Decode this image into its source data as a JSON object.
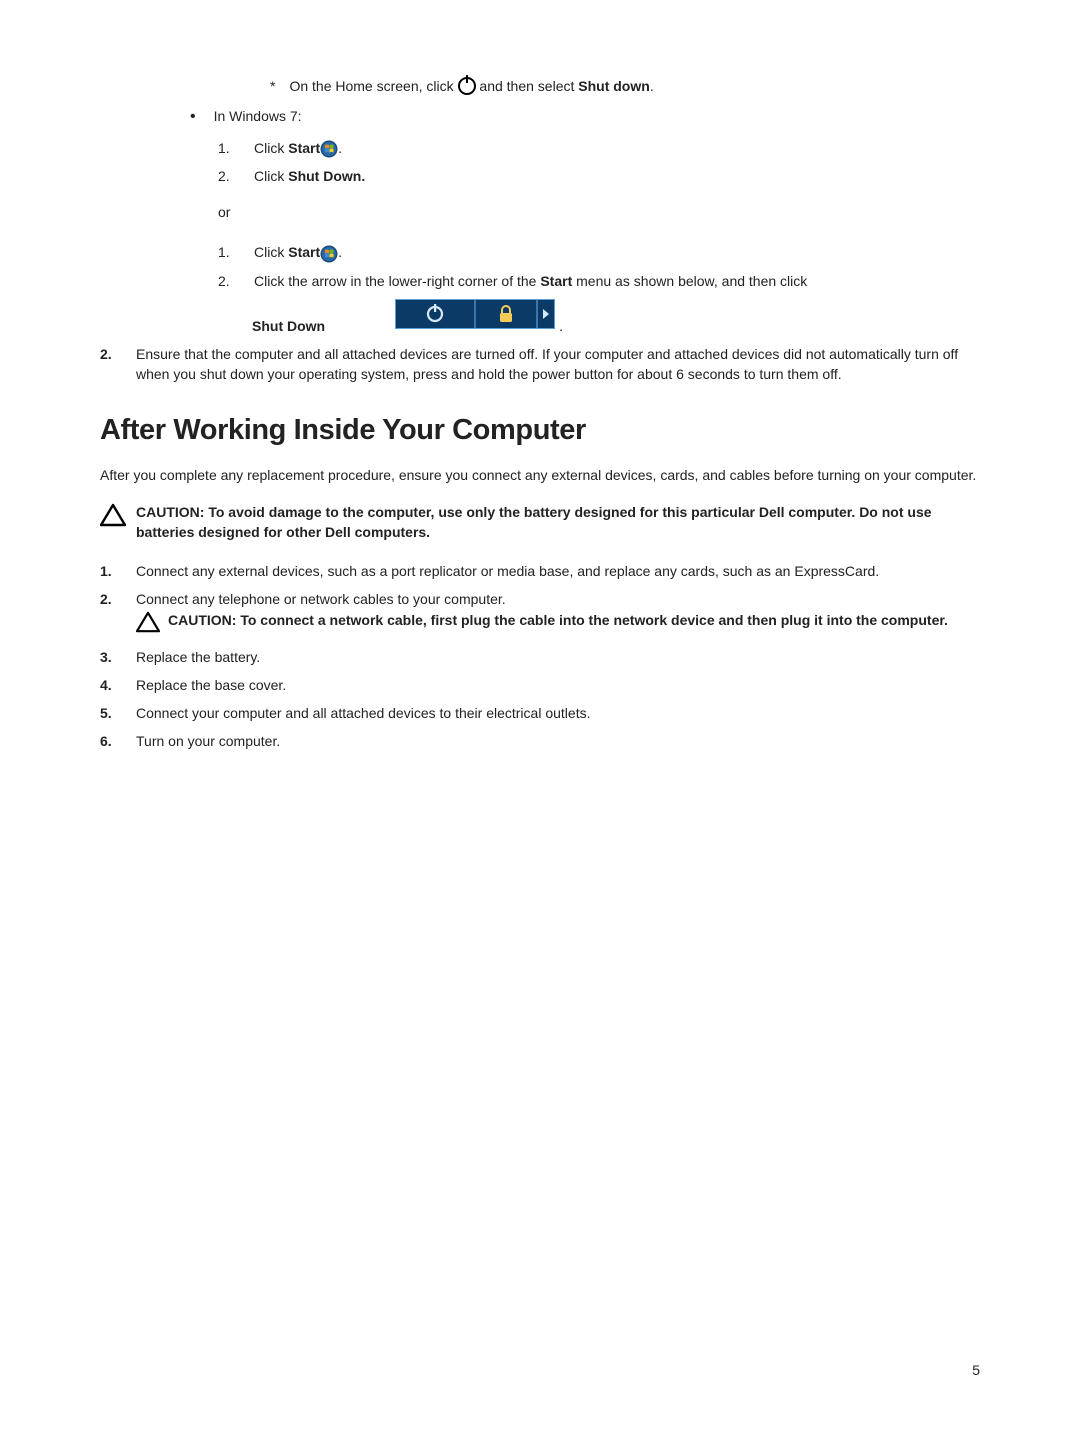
{
  "asterisk": {
    "marker": "*",
    "text_before": "On the Home screen, click ",
    "text_after": " and then select ",
    "bold_end": "Shut down",
    "period": "."
  },
  "bullet1": {
    "marker": "•",
    "text": "In Windows 7:"
  },
  "steps_a": {
    "s1_num": "1.",
    "s1_text": "Click ",
    "s1_bold": "Start",
    "s1_period": ".",
    "s2_num": "2.",
    "s2_text": "Click ",
    "s2_bold": "Shut Down."
  },
  "or_text": "or",
  "steps_b": {
    "s1_num": "1.",
    "s1_text": "Click ",
    "s1_bold": "Start",
    "s1_period": ".",
    "s2_num": "2.",
    "s2_text_before": "Click the arrow in the lower-right corner of the ",
    "s2_bold": "Start",
    "s2_text_after": " menu as shown below, and then click"
  },
  "shutdown_label": "Shut Down",
  "main_step_2": {
    "num": "2.",
    "text": "Ensure that the computer and all attached devices are turned off. If your computer and attached devices did not automatically turn off when you shut down your operating system, press and hold the power button for about 6 seconds to turn them off."
  },
  "section_title": "After Working Inside Your Computer",
  "intro_para": "After you complete any replacement procedure, ensure you connect any external devices, cards, and cables before turning on your computer.",
  "caution1": "CAUTION: To avoid damage to the computer, use only the battery designed for this particular Dell computer. Do not use batteries designed for other Dell computers.",
  "steps_after": {
    "s1_num": "1.",
    "s1_text": "Connect any external devices, such as a port replicator or media base, and replace any cards, such as an ExpressCard.",
    "s2_num": "2.",
    "s2_text": "Connect any telephone or network cables to your computer.",
    "caution2": "CAUTION: To connect a network cable, first plug the cable into the network device and then plug it into the computer.",
    "s3_num": "3.",
    "s3_text": "Replace the battery.",
    "s4_num": "4.",
    "s4_text": "Replace the base cover.",
    "s5_num": "5.",
    "s5_text": "Connect your computer and all attached devices to their electrical outlets.",
    "s6_num": "6.",
    "s6_text": "Turn on your computer."
  },
  "page_number": "5"
}
